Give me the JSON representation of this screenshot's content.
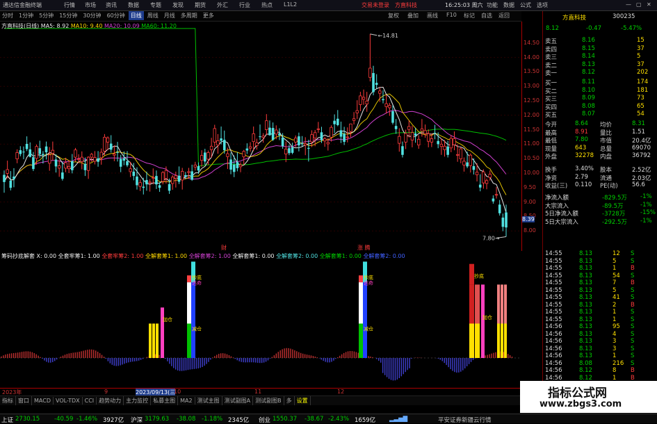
{
  "app": {
    "title": "通达信金融终端",
    "menu": [
      "行情",
      "市场",
      "资讯",
      "数据",
      "专题",
      "发现",
      "期货",
      "外汇",
      "行业",
      "热点",
      "L1L2"
    ],
    "center_red": "交易未登录",
    "center_red2": "方直科技",
    "right": [
      "功能",
      "数据",
      "公式",
      "选项"
    ],
    "time": "16:25:03 周六"
  },
  "timeframes": [
    "分时",
    "1分钟",
    "5分钟",
    "15分钟",
    "30分钟",
    "60分钟",
    "日线",
    "周线",
    "月线",
    "多周期",
    "更多"
  ],
  "right_btns": [
    "复权",
    "叠加",
    "画线",
    "F10",
    "标记",
    "自选",
    "返回"
  ],
  "legend_main": {
    "name": "方直科技(日线)",
    "ma5": "MA5: 8.92",
    "ma10": "MA10: 9.40",
    "ma20": "MA20: 10.09",
    "ma60": "MA60: 11.20"
  },
  "price_axis": [
    "14.50",
    "14.00",
    "13.50",
    "13.00",
    "12.50",
    "12.00",
    "11.50",
    "11.00",
    "10.50",
    "10.00",
    "9.50",
    "9.00",
    "8.50",
    "8.00"
  ],
  "price_marks": {
    "high": "14.81",
    "low": "7.80",
    "cur": "8.39",
    "left_mark": "财",
    "mid_mark": "涨 腾"
  },
  "legend_ind": {
    "name": "筹码抄底解套",
    "x": "X: 0.00",
    "items": [
      "全套牢筹1: 1.00",
      "全套牢筹2: 1.00",
      "全解套筹1: 1.00",
      "全解套筹2: 1.00",
      "全解套筹1: 0.00",
      "全解套筹2: 0.00",
      "全解套筹1: 0.00",
      "全解套筹2: 0.00",
      "全解套筹1: 0.00"
    ]
  },
  "ind_axis": [
    "2.00",
    "1.75",
    "1.50",
    "1.25",
    "1.00",
    "0.75",
    "0.50",
    "0.25",
    "0.00"
  ],
  "ind_labels": {
    "a": "抄底",
    "b": "逃命",
    "c": "加仓",
    "d": "减仓"
  },
  "time_axis": {
    "a": "2023年",
    "b": "9",
    "c": "2023/09/13(三",
    "d": "10",
    "e": "11",
    "f": "12"
  },
  "tabs": [
    "指标",
    "窗口",
    "MACD",
    "VOL-TDX",
    "CCI",
    "趋势动力",
    "主力监控",
    "私募主图",
    "MA2",
    "测试主图",
    "测试副图A",
    "测试副图B",
    "多",
    "设置"
  ],
  "stock": {
    "name": "方直科技",
    "code": "300235",
    "price": "8.12",
    "change": "-0.47",
    "pct": "-5.47%"
  },
  "sell": [
    {
      "l": "卖五",
      "p": "8.16",
      "v": "15"
    },
    {
      "l": "卖四",
      "p": "8.15",
      "v": "37"
    },
    {
      "l": "卖三",
      "p": "8.14",
      "v": "5"
    },
    {
      "l": "卖二",
      "p": "8.13",
      "v": "37"
    },
    {
      "l": "卖一",
      "p": "8.12",
      "v": "202"
    }
  ],
  "buy": [
    {
      "l": "买一",
      "p": "8.11",
      "v": "174"
    },
    {
      "l": "买二",
      "p": "8.10",
      "v": "181"
    },
    {
      "l": "买三",
      "p": "8.09",
      "v": "73"
    },
    {
      "l": "买四",
      "p": "8.08",
      "v": "65"
    },
    {
      "l": "买五",
      "p": "8.07",
      "v": "54"
    }
  ],
  "quote": [
    {
      "a": "今开",
      "b": "8.64",
      "c": "均价",
      "d": "8.31"
    },
    {
      "a": "最高",
      "b": "8.91",
      "c": "量比",
      "d": "1.51"
    },
    {
      "a": "最低",
      "b": "7.80",
      "c": "市值",
      "d": "20.4亿"
    },
    {
      "a": "现量",
      "b": "643",
      "c": "总量",
      "d": "69070"
    },
    {
      "a": "外盘",
      "b": "32278",
      "c": "内盘",
      "d": "36792"
    }
  ],
  "quote2": [
    {
      "a": "换手",
      "b": "3.40%",
      "c": "股本",
      "d": "2.52亿"
    },
    {
      "a": "净资",
      "b": "2.79",
      "c": "流通",
      "d": "2.03亿"
    },
    {
      "a": "收益(三)",
      "b": "0.110",
      "c": "PE(动)",
      "d": "56.6"
    }
  ],
  "flow": [
    {
      "a": "净流入额",
      "b": "-829.5万",
      "c": "-1%"
    },
    {
      "a": "大宗流入",
      "b": "-89.5万",
      "c": "-1%"
    },
    {
      "a": "5日净流入额",
      "b": "-3728万",
      "c": "-15%"
    },
    {
      "a": "5日大宗流入",
      "b": "-292.5万",
      "c": "-1%"
    }
  ],
  "ticks": [
    {
      "t": "14:55",
      "p": "8.13",
      "v": "12",
      "s": "S"
    },
    {
      "t": "14:55",
      "p": "8.13",
      "v": "5",
      "s": "S"
    },
    {
      "t": "14:55",
      "p": "8.13",
      "v": "1",
      "s": "B"
    },
    {
      "t": "14:55",
      "p": "8.13",
      "v": "54",
      "s": "S"
    },
    {
      "t": "14:55",
      "p": "8.13",
      "v": "7",
      "s": "B"
    },
    {
      "t": "14:55",
      "p": "8.13",
      "v": "5",
      "s": "S"
    },
    {
      "t": "14:55",
      "p": "8.13",
      "v": "41",
      "s": "S"
    },
    {
      "t": "14:55",
      "p": "8.13",
      "v": "2",
      "s": "B"
    },
    {
      "t": "14:55",
      "p": "8.13",
      "v": "1",
      "s": "S"
    },
    {
      "t": "14:55",
      "p": "8.13",
      "v": "1",
      "s": "S"
    },
    {
      "t": "14:56",
      "p": "8.13",
      "v": "95",
      "s": "S"
    },
    {
      "t": "14:56",
      "p": "8.13",
      "v": "4",
      "s": "S"
    },
    {
      "t": "14:56",
      "p": "8.13",
      "v": "3",
      "s": "S"
    },
    {
      "t": "14:56",
      "p": "8.13",
      "v": "3",
      "s": "S"
    },
    {
      "t": "14:56",
      "p": "8.13",
      "v": "1",
      "s": "S"
    },
    {
      "t": "14:56",
      "p": "8.08",
      "v": "216",
      "s": "S"
    },
    {
      "t": "14:56",
      "p": "8.12",
      "v": "8",
      "s": "B"
    },
    {
      "t": "14:56",
      "p": "8.12",
      "v": "1",
      "s": "B"
    }
  ],
  "status": {
    "sh": "上证",
    "sh_v": "2730.15",
    "sh_c": "-40.59",
    "sh_p": "-1.46%",
    "sh_a": "3927亿",
    "sz": "沪深",
    "sz_v": "3179.63",
    "sz_c": "-38.08",
    "sz_p": "-1.18%",
    "sz_a": "2345亿",
    "cy": "创业",
    "cy_v": "1550.37",
    "cy_c": "-38.67",
    "cy_p": "-2.43%",
    "cy_a": "1659亿",
    "broker": "平安证券新疆云行情"
  },
  "watermark": {
    "line1": "指标公式网",
    "line2": "www.zbgs3.com"
  },
  "chart_data": {
    "type": "candlestick",
    "ylim": [
      7.5,
      15.0
    ],
    "ma": [
      "MA5",
      "MA10",
      "MA20",
      "MA60"
    ],
    "candles": [
      [
        9.94,
        10.09,
        9.32,
        9.69
      ],
      [
        9.99,
        10.43,
        9.82,
        10.12
      ],
      [
        9.74,
        10.07,
        9.4,
        9.49
      ],
      [
        9.88,
        10.17,
        9.51,
        9.79
      ],
      [
        10.49,
        10.82,
        10.34,
        10.71
      ],
      [
        10.79,
        10.93,
        10.58,
        10.66
      ],
      [
        10.74,
        10.92,
        10.48,
        10.72
      ],
      [
        11.01,
        11.27,
        10.76,
        10.83
      ],
      [
        10.82,
        11.06,
        10.54,
        10.56
      ],
      [
        10.55,
        10.73,
        10.07,
        10.14
      ],
      [
        10.51,
        10.99,
        10.29,
        10.92
      ],
      [
        10.86,
        11.12,
        10.53,
        10.66
      ],
      [
        10.66,
        10.76,
        10.33,
        10.62
      ],
      [
        10.92,
        11.09,
        10.47,
        10.72
      ],
      [
        10.34,
        10.9,
        10.08,
        10.63
      ],
      [
        10.68,
        11.09,
        10.43,
        10.79
      ],
      [
        10.47,
        10.65,
        10.02,
        10.23
      ],
      [
        10.17,
        10.45,
        9.87,
        10.25
      ],
      [
        10.02,
        10.39,
        9.74,
        9.8
      ],
      [
        10.17,
        10.53,
        10.03,
        10.36
      ],
      [
        10.15,
        10.44,
        10.0,
        10.22
      ],
      [
        10.41,
        10.66,
        9.99,
        10.1
      ],
      [
        10.55,
        10.87,
        10.4,
        10.8
      ],
      [
        10.49,
        10.65,
        10.35,
        10.49
      ],
      [
        10.4,
        10.75,
        10.13,
        10.55
      ],
      [
        10.32,
        10.54,
        9.9,
        10.1
      ],
      [
        10.09,
        10.58,
        9.8,
        10.55
      ],
      [
        10.55,
        10.7,
        10.39,
        10.65
      ],
      [
        10.41,
        10.76,
        10.3,
        10.54
      ],
      [
        10.51,
        10.76,
        10.22,
        10.39
      ],
      [
        10.53,
        10.85,
        10.29,
        10.72
      ],
      [
        10.76,
        11.35,
        10.61,
        11.24
      ],
      [
        11.07,
        11.27,
        10.81,
        11.22
      ],
      [
        11.02,
        11.31,
        10.71,
        10.81
      ],
      [
        10.62,
        10.96,
        10.41,
        10.66
      ],
      [
        10.72,
        11.08,
        10.4,
        10.71
      ],
      [
        10.49,
        10.63,
        10.03,
        10.22
      ],
      [
        10.51,
        10.75,
        10.27,
        10.43
      ],
      [
        10.41,
        10.76,
        10.21,
        10.27
      ],
      [
        10.05,
        10.39,
        9.86,
        10.15
      ],
      [
        10.05,
        10.35,
        9.75,
        9.9
      ],
      [
        9.88,
        10.2,
        9.43,
        9.58
      ],
      [
        9.54,
        9.78,
        9.38,
        9.67
      ],
      [
        9.53,
        9.84,
        9.26,
        9.49
      ],
      [
        9.76,
        10.05,
        9.39,
        9.61
      ],
      [
        9.66,
        9.79,
        9.36,
        9.69
      ],
      [
        9.85,
        10.16,
        9.61,
        9.85
      ],
      [
        9.9,
        10.09,
        9.45,
        9.61
      ],
      [
        9.58,
        9.68,
        9.35,
        9.49
      ],
      [
        9.71,
        10.07,
        9.61,
        10.02
      ],
      [
        9.81,
        10.23,
        9.64,
        10.09
      ],
      [
        9.62,
        9.81,
        9.28,
        9.39
      ],
      [
        9.64,
        9.93,
        9.42,
        9.86
      ],
      [
        9.82,
        10.05,
        9.5,
        9.91
      ],
      [
        9.91,
        10.23,
        9.62,
        9.7
      ],
      [
        9.76,
        10.18,
        9.43,
        10.06
      ],
      [
        9.93,
        10.04,
        9.79,
        9.87
      ],
      [
        10.02,
        10.18,
        9.82,
        10.05
      ],
      [
        10.06,
        10.29,
        9.73,
        9.77
      ],
      [
        10.21,
        10.39,
        10.09,
        10.28
      ],
      [
        10.24,
        10.37,
        9.97,
        10.09
      ],
      [
        10.44,
        10.79,
        10.22,
        10.61
      ],
      [
        10.71,
        10.84,
        10.29,
        10.4
      ],
      [
        10.48,
        10.78,
        10.28,
        10.71
      ],
      [
        10.81,
        11.22,
        10.53,
        10.93
      ],
      [
        11.07,
        11.67,
        10.9,
        11.54
      ],
      [
        10.97,
        11.35,
        10.67,
        11.12
      ],
      [
        11.2,
        11.61,
        10.99,
        11.12
      ],
      [
        11.15,
        11.47,
        10.67,
        10.79
      ],
      [
        10.57,
        10.88,
        10.14,
        10.67
      ],
      [
        10.47,
        10.71,
        9.96,
        10.12
      ],
      [
        10.29,
        10.61,
        9.86,
        10.04
      ],
      [
        10.38,
        10.72,
        10.06,
        10.17
      ],
      [
        10.22,
        10.37,
        10.03,
        10.28
      ],
      [
        10.56,
        10.8,
        10.28,
        10.75
      ],
      [
        10.85,
        11.03,
        10.66,
        10.78
      ],
      [
        10.86,
        11.07,
        10.74,
        10.91
      ],
      [
        11.09,
        11.61,
        10.76,
        11.36
      ],
      [
        10.95,
        11.19,
        10.81,
        11.05
      ],
      [
        11.27,
        11.68,
        11.14,
        11.25
      ],
      [
        11.23,
        11.38,
        11.05,
        11.28
      ],
      [
        11.5,
        12.04,
        11.31,
        11.81
      ],
      [
        11.57,
        11.82,
        11.29,
        11.31
      ],
      [
        11.56,
        11.75,
        11.11,
        11.15
      ],
      [
        11.35,
        11.65,
        11.17,
        11.49
      ],
      [
        11.37,
        11.55,
        11.14,
        11.31
      ],
      [
        11.23,
        11.38,
        10.84,
        10.93
      ],
      [
        10.66,
        11.09,
        10.38,
        10.83
      ],
      [
        10.86,
        10.98,
        10.62,
        10.69
      ],
      [
        10.89,
        11.05,
        10.65,
        10.7
      ],
      [
        11.07,
        11.3,
        10.9,
        11.21
      ],
      [
        11.27,
        11.4,
        10.75,
        10.96
      ],
      [
        11.03,
        11.28,
        10.92,
        11.0
      ],
      [
        10.97,
        11.24,
        10.62,
        11.02
      ],
      [
        10.87,
        11.15,
        10.4,
        10.84
      ],
      [
        11.08,
        11.48,
        10.9,
        11.33
      ],
      [
        11.21,
        11.49,
        10.93,
        11.4
      ],
      [
        11.51,
        11.77,
        11.39,
        11.53
      ],
      [
        11.41,
        11.6,
        11.04,
        11.14
      ],
      [
        11.11,
        11.26,
        10.91,
        11.19
      ],
      [
        11.01,
        11.21,
        10.78,
        11.06
      ],
      [
        11.24,
        11.65,
        11.09,
        11.58
      ],
      [
        11.81,
        12.03,
        11.38,
        11.69
      ],
      [
        11.88,
        12.18,
        11.62,
        11.66
      ],
      [
        11.48,
        11.78,
        11.04,
        11.26
      ],
      [
        11.36,
        11.6,
        10.97,
        11.08
      ],
      [
        11.24,
        11.58,
        11.06,
        11.25
      ],
      [
        11.44,
        11.71,
        11.24,
        11.7
      ],
      [
        11.82,
        12.11,
        11.68,
        11.88
      ],
      [
        12.08,
        12.52,
        11.87,
        12.16
      ],
      [
        12.37,
        12.81,
        12.14,
        12.67
      ],
      [
        12.55,
        12.89,
        12.36,
        12.62
      ],
      [
        12.39,
        12.81,
        12.12,
        12.49
      ],
      [
        13.31,
        14.81,
        13.17,
        13.63
      ],
      [
        13.46,
        13.71,
        12.69,
        12.8
      ],
      [
        13.12,
        13.42,
        12.93,
        13.05
      ],
      [
        12.76,
        12.96,
        12.46,
        12.84
      ],
      [
        12.56,
        12.86,
        12.41,
        12.52
      ],
      [
        12.3,
        12.71,
        12.06,
        12.4
      ],
      [
        12.26,
        12.43,
        11.98,
        12.34
      ],
      [
        12.14,
        12.34,
        11.68,
        11.74
      ],
      [
        11.63,
        11.87,
        11.36,
        11.52
      ],
      [
        11.03,
        11.55,
        10.74,
        11.27
      ],
      [
        10.93,
        11.09,
        10.54,
        10.63
      ],
      [
        11.07,
        11.5,
        10.83,
        11.37
      ],
      [
        11.51,
        11.82,
        11.23,
        11.61
      ],
      [
        11.14,
        11.64,
        10.89,
        11.4
      ],
      [
        11.37,
        11.57,
        11.05,
        11.29
      ],
      [
        10.97,
        11.31,
        10.84,
        11.17
      ],
      [
        11.45,
        11.87,
        11.26,
        11.53
      ],
      [
        11.36,
        11.68,
        11.22,
        11.47
      ],
      [
        11.1,
        11.51,
        10.89,
        11.36
      ],
      [
        11.07,
        11.37,
        10.9,
        11.19
      ],
      [
        11.39,
        11.67,
        11.17,
        11.37
      ],
      [
        11.11,
        11.41,
        10.86,
        11.0
      ],
      [
        10.92,
        11.2,
        10.63,
        11.0
      ],
      [
        10.81,
        11.14,
        10.57,
        10.93
      ],
      [
        10.92,
        11.12,
        10.54,
        10.63
      ],
      [
        10.87,
        11.31,
        10.72,
        11.2
      ],
      [
        10.98,
        11.44,
        10.79,
        11.19
      ],
      [
        10.62,
        10.99,
        10.39,
        10.64
      ],
      [
        10.49,
        10.89,
        10.34,
        10.84
      ],
      [
        10.28,
        10.54,
        10.05,
        10.41
      ],
      [
        10.37,
        10.74,
        10.17,
        10.23
      ],
      [
        10.26,
        10.68,
        10.02,
        10.62
      ],
      [
        10.24,
        10.51,
        9.95,
        10.11
      ],
      [
        9.94,
        10.34,
        9.71,
        10.03
      ],
      [
        9.6,
        9.96,
        9.37,
        9.5
      ],
      [
        9.66,
        10.13,
        9.46,
        10.04
      ],
      [
        9.64,
        9.81,
        9.44,
        9.74
      ],
      [
        9.85,
        10.09,
        9.74,
        9.96
      ],
      [
        9.12,
        9.23,
        8.94,
        9.02
      ],
      [
        9.24,
        9.52,
        9.12,
        9.26
      ],
      [
        8.91,
        9.07,
        8.53,
        8.61
      ],
      [
        8.46,
        8.6,
        7.99,
        8.14
      ],
      [
        8.64,
        8.91,
        7.8,
        8.12
      ]
    ]
  }
}
